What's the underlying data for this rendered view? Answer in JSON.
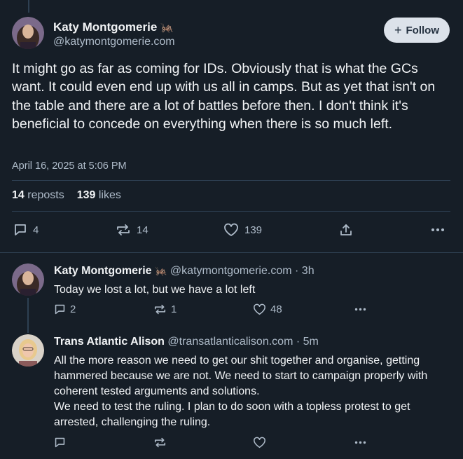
{
  "main_post": {
    "author_name": "Katy Montgomerie",
    "author_emoji": "🦗",
    "author_handle": "@katymontgomerie.com",
    "follow_label": "Follow",
    "text": "It might go as far as coming for IDs. Obviously that is what the GCs want. It could even end up with us all in camps. But as yet that isn't on the table and there are a lot of battles before then. I don't think it's beneficial to concede on everything when there is so much left.",
    "timestamp": "April 16, 2025 at 5:06 PM",
    "reposts_count": "14",
    "reposts_label": "reposts",
    "likes_count": "139",
    "likes_label": "likes",
    "actions": {
      "replies": "4",
      "reposts": "14",
      "likes": "139"
    }
  },
  "replies": [
    {
      "author_name": "Katy Montgomerie",
      "author_emoji": "🦗",
      "author_handle": "@katymontgomerie.com",
      "time": "· 3h",
      "text": "Today we lost a lot, but we have a lot left",
      "reply_count": "2",
      "repost_count": "1",
      "like_count": "48"
    },
    {
      "author_name": "Trans Atlantic Alison",
      "author_handle": "@transatlanticalison.com",
      "time": "· 5m",
      "text_line1": "All the more reason we need to get our shit together and organise, getting hammered because we are not. We need to start to campaign properly with coherent tested arguments and solutions.",
      "text_line2": "We need to test the ruling. I plan to do soon with a topless protest to get arrested, challenging the ruling.",
      "reply_count": "",
      "repost_count": "",
      "like_count": ""
    }
  ],
  "colors": {
    "background": "#161e27",
    "text": "#f1f3f5",
    "muted": "#aebbc9",
    "divider": "#2e4052",
    "follow_bg": "#dce2ea"
  },
  "icons": [
    "reply-icon",
    "repost-icon",
    "like-icon",
    "share-icon",
    "more-icon",
    "plus-icon"
  ]
}
